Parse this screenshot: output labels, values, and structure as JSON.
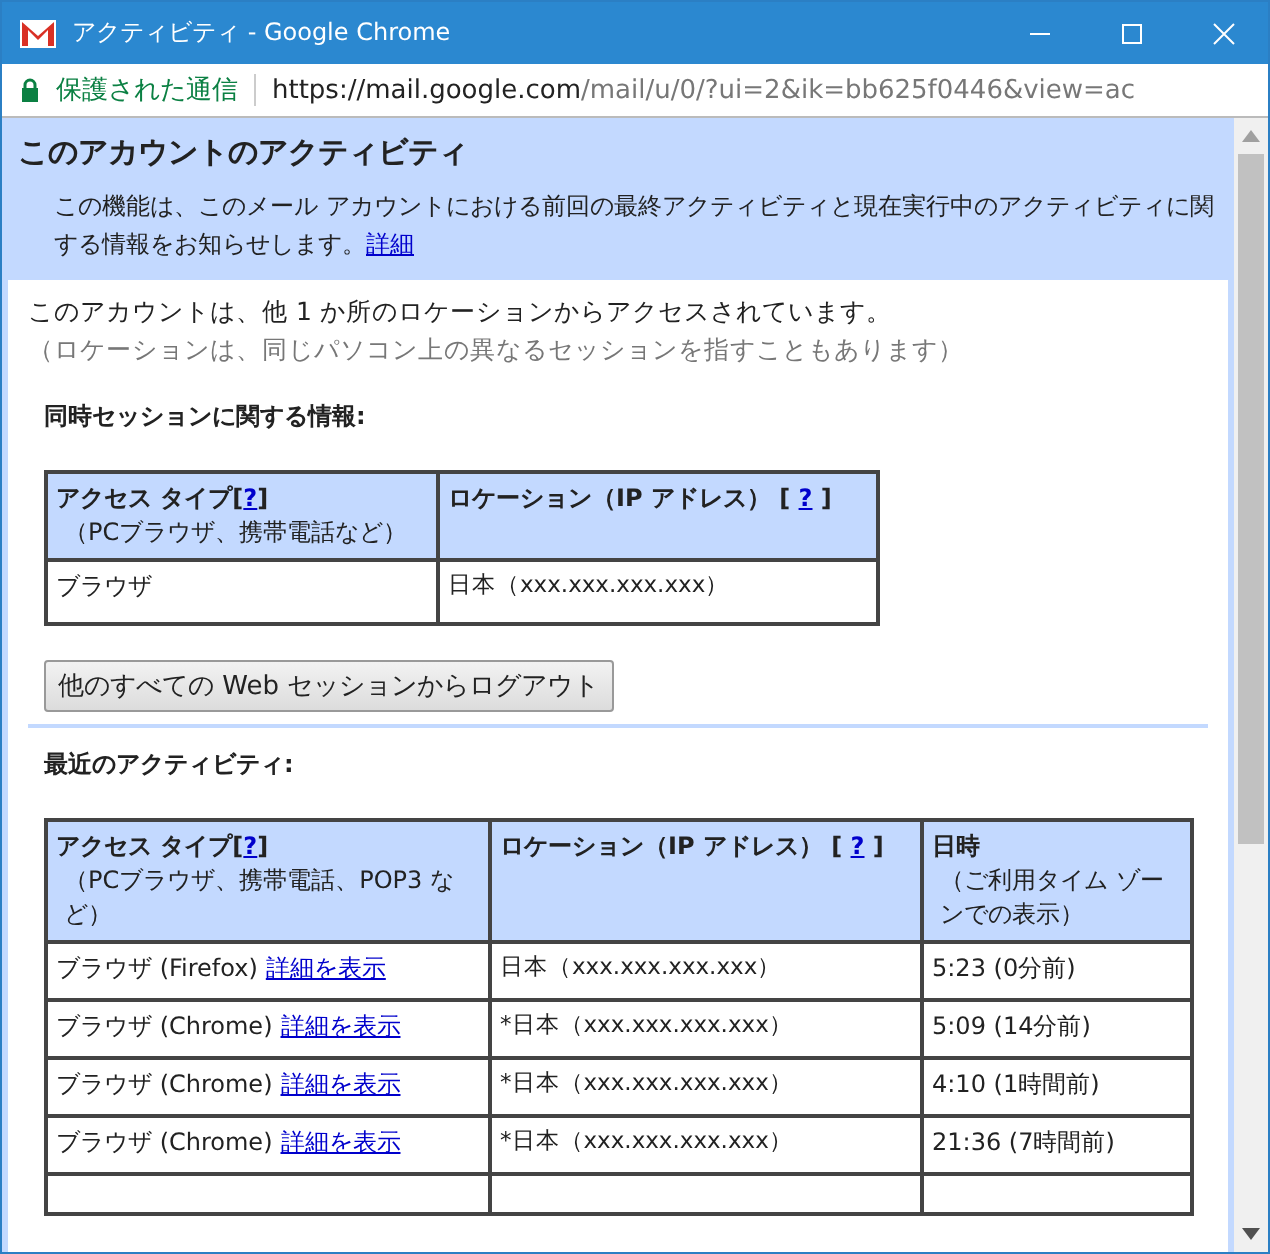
{
  "window": {
    "title": "アクティビティ - Google Chrome"
  },
  "address_bar": {
    "secure_label": "保護された通信",
    "url_host": "https://mail.google.com",
    "url_path": "/mail/u/0/?ui=2&ik=bb625f0446&view=ac"
  },
  "header": {
    "title": "このアカウントのアクティビティ",
    "description": "この機能は、このメール アカウントにおける前回の最終アクティビティと現在実行中のアクティビティに関する情報をお知らせします。",
    "link": "詳細"
  },
  "notice": "このアカウントは、他 1 か所のロケーションからアクセスされています。",
  "note": "（ロケーションは、同じパソコン上の異なるセッションを指すこともあります）",
  "concurrent": {
    "heading": "同時セッションに関する情報:",
    "columns": [
      {
        "before": "アクセス タイプ[",
        "help": "?",
        "after": "]",
        "sub": "（PCブラウザ、携帯電話など）"
      },
      {
        "before": "ロケーション（IP アドレス） [ ",
        "help": "?",
        "after": " ]"
      }
    ],
    "rows": [
      {
        "type": "ブラウザ",
        "location": "日本（xxx.xxx.xxx.xxx）"
      }
    ]
  },
  "logout_button": "他のすべての Web セッションからログアウト",
  "recent": {
    "heading": "最近のアクティビティ:",
    "columns": [
      {
        "before": "アクセス タイプ[",
        "help": "?",
        "after": "]",
        "sub": "（PCブラウザ、携帯電話、POP3 など）"
      },
      {
        "before": "ロケーション（IP アドレス） [ ",
        "help": "?",
        "after": " ]"
      },
      {
        "before": "日時",
        "sub": "（ご利用タイム ゾーンでの表示）"
      }
    ],
    "rows": [
      {
        "type": "ブラウザ (Firefox)",
        "link": "詳細を表示",
        "location": "日本（xxx.xxx.xxx.xxx）",
        "time": "5:23 (0分前)"
      },
      {
        "type": "ブラウザ (Chrome)",
        "link": "詳細を表示",
        "location": "*日本（xxx.xxx.xxx.xxx）",
        "time": "5:09 (14分前)"
      },
      {
        "type": "ブラウザ (Chrome)",
        "link": "詳細を表示",
        "location": "*日本（xxx.xxx.xxx.xxx）",
        "time": "4:10 (1時間前)"
      },
      {
        "type": "ブラウザ (Chrome)",
        "link": "詳細を表示",
        "location": "*日本（xxx.xxx.xxx.xxx）",
        "time": "21:36 (7時間前)"
      }
    ]
  }
}
